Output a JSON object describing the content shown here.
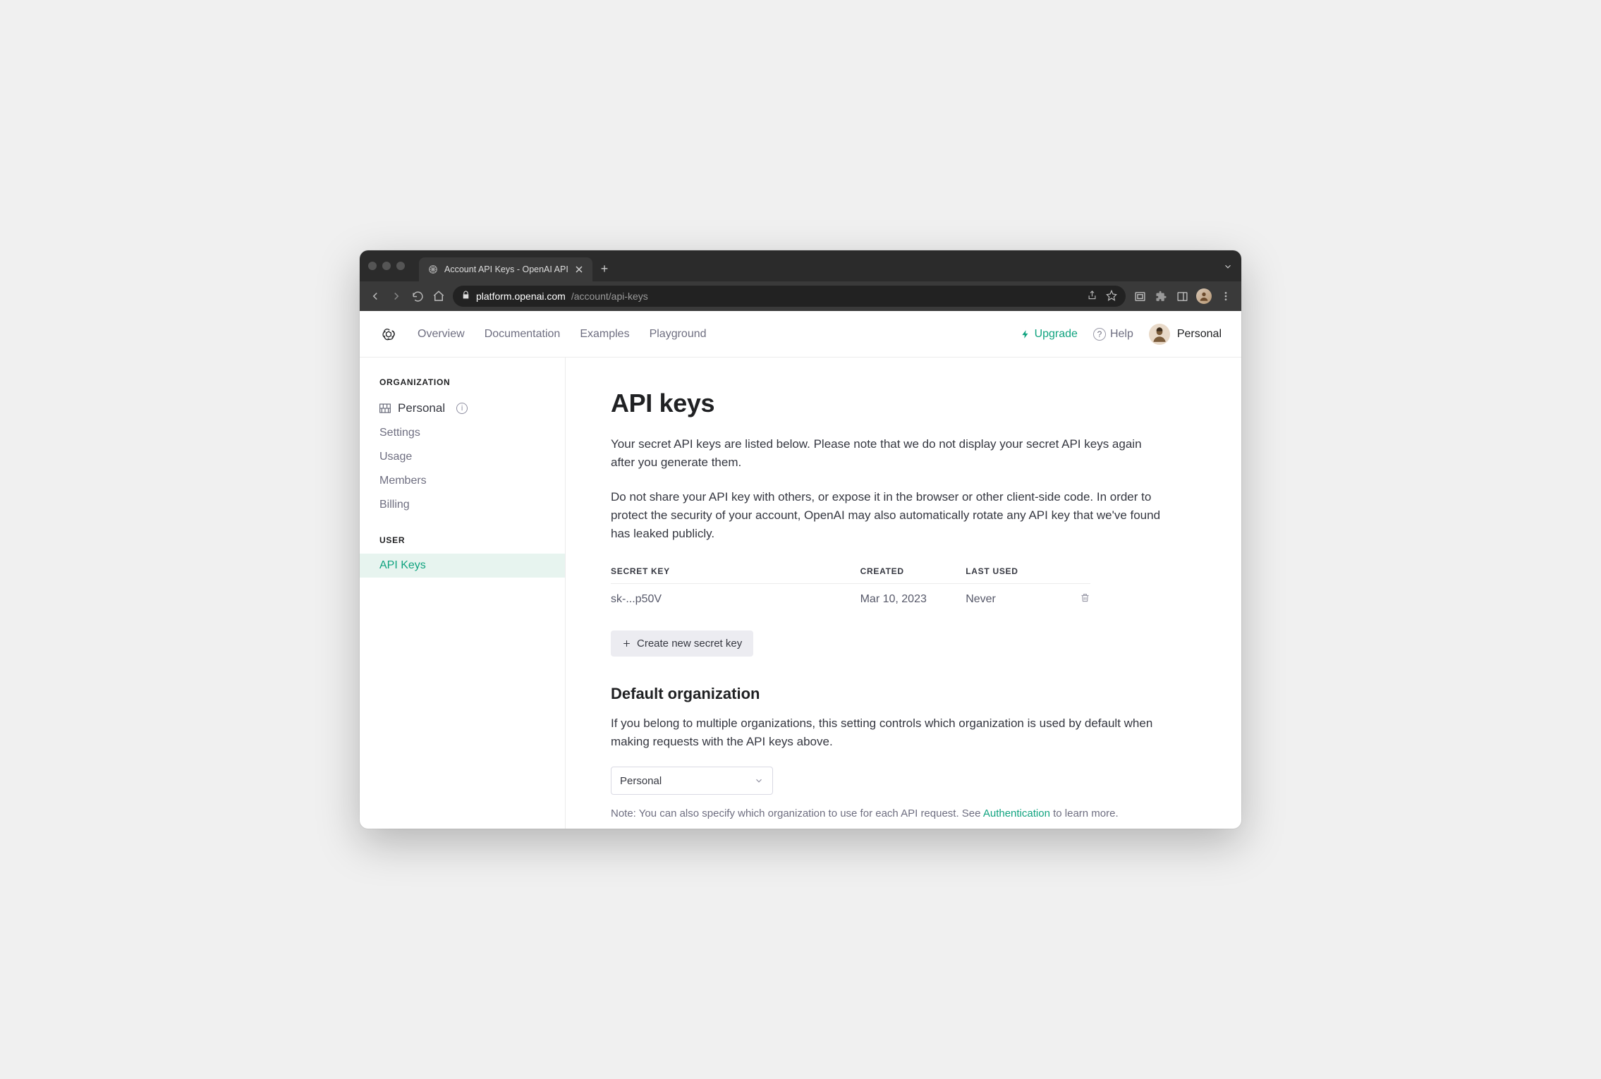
{
  "browser": {
    "tab_title": "Account API Keys - OpenAI API",
    "url_host": "platform.openai.com",
    "url_path": "/account/api-keys"
  },
  "topnav": {
    "links": [
      "Overview",
      "Documentation",
      "Examples",
      "Playground"
    ],
    "upgrade": "Upgrade",
    "help": "Help",
    "user": "Personal"
  },
  "sidebar": {
    "section_org": "ORGANIZATION",
    "personal": "Personal",
    "org_items": [
      "Settings",
      "Usage",
      "Members",
      "Billing"
    ],
    "section_user": "USER",
    "user_items": [
      "API Keys"
    ]
  },
  "main": {
    "title": "API keys",
    "p1": "Your secret API keys are listed below. Please note that we do not display your secret API keys again after you generate them.",
    "p2": "Do not share your API key with others, or expose it in the browser or other client-side code. In order to protect the security of your account, OpenAI may also automatically rotate any API key that we've found has leaked publicly.",
    "table": {
      "headers": [
        "SECRET KEY",
        "CREATED",
        "LAST USED"
      ],
      "rows": [
        {
          "key": "sk-...p50V",
          "created": "Mar 10, 2023",
          "last_used": "Never"
        }
      ]
    },
    "create_label": "Create new secret key",
    "default_org_title": "Default organization",
    "default_org_desc": "If you belong to multiple organizations, this setting controls which organization is used by default when making requests with the API keys above.",
    "org_select_value": "Personal",
    "note_prefix": "Note: You can also specify which organization to use for each API request. See ",
    "note_link": "Authentication",
    "note_suffix": " to learn more."
  }
}
